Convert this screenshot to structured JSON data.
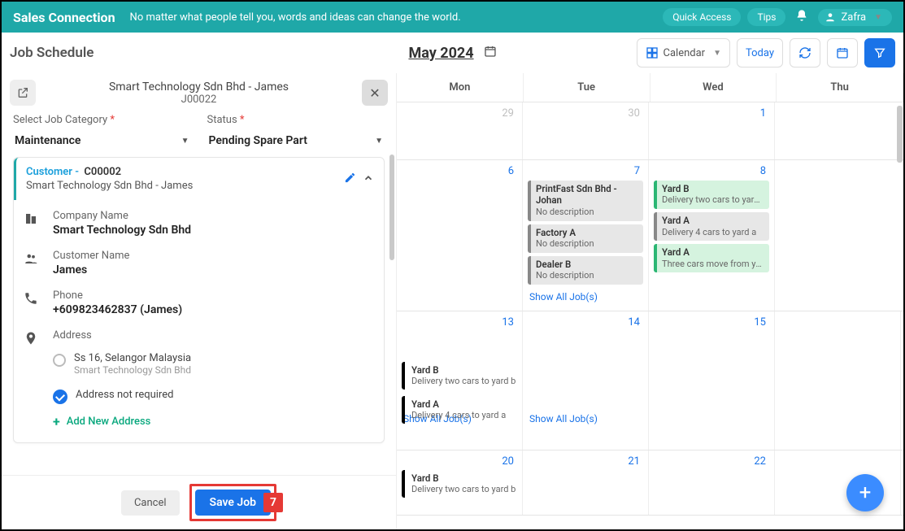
{
  "topbar": {
    "brand": "Sales Connection",
    "tagline": "No matter what people tell you, words and ideas can change the world.",
    "quick": "Quick Access",
    "tips": "Tips",
    "user": "Zafra"
  },
  "header": {
    "title": "Job Schedule",
    "month": "May 2024",
    "view": "Calendar",
    "today": "Today"
  },
  "panel": {
    "title": "Smart Technology Sdn Bhd - James",
    "jobno": "J00022",
    "cat_label": "Select Job Category",
    "cat_value": "Maintenance",
    "status_label": "Status",
    "status_value": "Pending Spare Part",
    "customer_label": "Customer -",
    "customer_id": "C00002",
    "customer_name_line": "Smart Technology Sdn Bhd - James",
    "company_label": "Company Name",
    "company_value": "Smart Technology Sdn Bhd",
    "custname_label": "Customer Name",
    "custname_value": "James",
    "phone_label": "Phone",
    "phone_value": "+609823462837 (James)",
    "address_label": "Address",
    "addr1_l1": "Ss 16, Selangor Malaysia",
    "addr1_l2": "Smart Technology Sdn Bhd",
    "addr_none": "Address not required",
    "add_addr": "Add New Address",
    "cancel": "Cancel",
    "save": "Save Job",
    "callout": "7"
  },
  "cal": {
    "days": [
      "Mon",
      "Tue",
      "Wed",
      "Thu"
    ],
    "show_all": "Show All Job(s)",
    "w1": {
      "mon": "29",
      "tue": "30",
      "wed": "1"
    },
    "w2": {
      "mon": "6",
      "tue": "7",
      "wed": "8",
      "tue_jobs": [
        {
          "t": "PrintFast Sdn Bhd - Johan",
          "d": "No description"
        },
        {
          "t": "Factory A",
          "d": "No description"
        },
        {
          "t": "Dealer B",
          "d": "No description"
        }
      ],
      "wed_jobs": [
        {
          "t": "Yard B",
          "d": "Delivery two cars to yard b"
        },
        {
          "t": "Yard A",
          "d": "Delivery 4 cars to yard a"
        },
        {
          "t": "Yard A",
          "d": "Three cars move from yard A to dealer"
        }
      ]
    },
    "w3": {
      "mon": "13",
      "tue": "14",
      "wed": "15",
      "span1": {
        "t": "Yard B",
        "d": "Delivery two cars to yard b"
      },
      "span2": {
        "t": "Yard A",
        "d": "Delivery 4 cars to yard a"
      }
    },
    "w4": {
      "mon": "20",
      "tue": "21",
      "wed": "22",
      "span1": {
        "t": "Yard B",
        "d": "Delivery two cars to yard b"
      }
    }
  }
}
